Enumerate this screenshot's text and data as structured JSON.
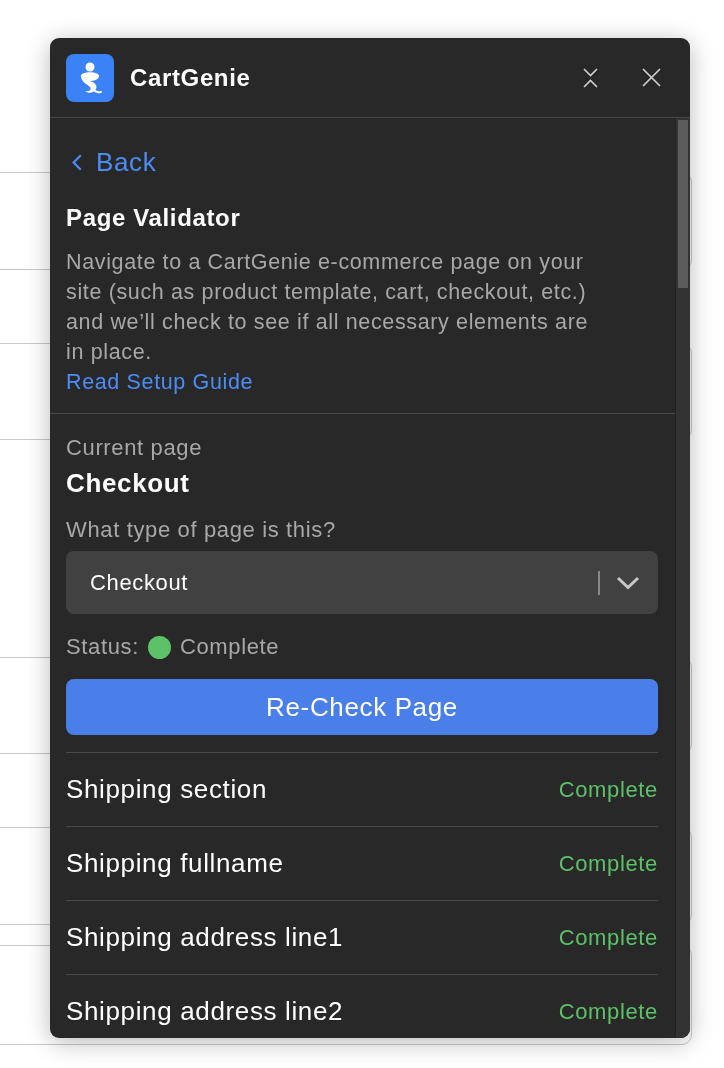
{
  "header": {
    "title": "CartGenie"
  },
  "nav": {
    "back": "Back"
  },
  "validator": {
    "title": "Page Validator",
    "description": "Navigate to a CartGenie e-commerce page on your site (such as product template, cart, checkout, etc.) and we’ll check to see if all necessary elements are in place.",
    "link": "Read Setup Guide"
  },
  "current_page": {
    "label": "Current page",
    "value": "Checkout"
  },
  "page_type": {
    "label": "What type of page is this?",
    "value": "Checkout"
  },
  "status": {
    "label": "Status:",
    "value": "Complete",
    "passed": true
  },
  "recheck_button": "Re-Check Page",
  "checks": [
    {
      "name": "Shipping section",
      "status": "Complete",
      "passed": true
    },
    {
      "name": "Shipping fullname",
      "status": "Complete",
      "passed": true
    },
    {
      "name": "Shipping address line1",
      "status": "Complete",
      "passed": true
    },
    {
      "name": "Shipping address line2",
      "status": "Complete",
      "passed": true
    }
  ]
}
